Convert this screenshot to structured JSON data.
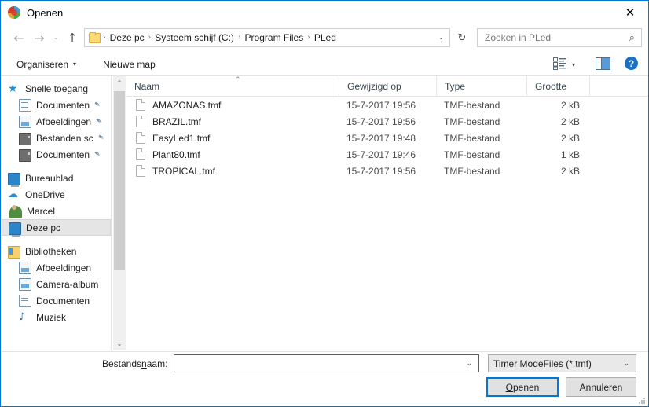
{
  "window": {
    "title": "Openen",
    "app_icon": "pled-logo-icon",
    "close_label": "✕"
  },
  "nav": {
    "back": "←",
    "forward": "→",
    "history": "⌄",
    "up": "↑",
    "refresh": "↻",
    "dropdown_caret": "⌄"
  },
  "address": {
    "folder_icon": "folder-icon",
    "separator": "›",
    "crumbs": [
      {
        "label": "Deze pc"
      },
      {
        "label": "Systeem schijf (C:)"
      },
      {
        "label": "Program Files"
      },
      {
        "label": "PLed"
      }
    ]
  },
  "search": {
    "placeholder": "Zoeken in PLed",
    "value": "",
    "icon": "⌕"
  },
  "commandbar": {
    "organiseren": "Organiseren",
    "nieuwe_map": "Nieuwe map",
    "caret": "▾",
    "help": "?"
  },
  "sidebar": {
    "items": [
      {
        "label": "Snelle toegang",
        "icon": "star-icon",
        "indent": 0,
        "pinned": false,
        "selected": false
      },
      {
        "label": "Documenten",
        "icon": "document-icon",
        "indent": 1,
        "pinned": true,
        "selected": false
      },
      {
        "label": "Afbeeldingen",
        "icon": "picture-icon",
        "indent": 1,
        "pinned": true,
        "selected": false
      },
      {
        "label": "Bestanden sc",
        "icon": "drive-icon",
        "indent": 1,
        "pinned": true,
        "selected": false
      },
      {
        "label": "Documenten",
        "icon": "drive-icon",
        "indent": 1,
        "pinned": true,
        "selected": false
      },
      {
        "label": "Bureaublad",
        "icon": "desktop-icon",
        "indent": 0,
        "pinned": false,
        "selected": false
      },
      {
        "label": "OneDrive",
        "icon": "cloud-icon",
        "indent": 0,
        "pinned": false,
        "selected": false
      },
      {
        "label": "Marcel",
        "icon": "user-icon",
        "indent": 0,
        "pinned": false,
        "selected": false
      },
      {
        "label": "Deze pc",
        "icon": "computer-icon",
        "indent": 0,
        "pinned": false,
        "selected": true
      },
      {
        "label": "Bibliotheken",
        "icon": "library-icon",
        "indent": 0,
        "pinned": false,
        "selected": false
      },
      {
        "label": "Afbeeldingen",
        "icon": "picture-icon",
        "indent": 1,
        "pinned": false,
        "selected": false
      },
      {
        "label": "Camera-album",
        "icon": "picture-icon",
        "indent": 1,
        "pinned": false,
        "selected": false
      },
      {
        "label": "Documenten",
        "icon": "document-icon",
        "indent": 1,
        "pinned": false,
        "selected": false
      },
      {
        "label": "Muziek",
        "icon": "music-icon",
        "indent": 1,
        "pinned": false,
        "selected": false
      }
    ],
    "pin_glyph": "✒",
    "scroll_up": "⌃",
    "scroll_down": "⌄"
  },
  "filelist": {
    "columns": [
      "Naam",
      "Gewijzigd op",
      "Type",
      "Grootte"
    ],
    "sort_caret": "⌃",
    "rows": [
      {
        "name": "AMAZONAS.tmf",
        "modified": "15-7-2017 19:56",
        "type": "TMF-bestand",
        "size": "2 kB"
      },
      {
        "name": "BRAZIL.tmf",
        "modified": "15-7-2017 19:56",
        "type": "TMF-bestand",
        "size": "2 kB"
      },
      {
        "name": "EasyLed1.tmf",
        "modified": "15-7-2017 19:48",
        "type": "TMF-bestand",
        "size": "2 kB"
      },
      {
        "name": "Plant80.tmf",
        "modified": "15-7-2017 19:46",
        "type": "TMF-bestand",
        "size": "1 kB"
      },
      {
        "name": "TROPICAL.tmf",
        "modified": "15-7-2017 19:56",
        "type": "TMF-bestand",
        "size": "2 kB"
      }
    ]
  },
  "bottom": {
    "filename_label_pre": "Bestands",
    "filename_label_accel": "n",
    "filename_label_post": "aam:",
    "filename_value": "",
    "filename_placeholder": "",
    "filter_value": "Timer ModeFiles (*.tmf)",
    "open_label_accel": "O",
    "open_label_post": "penen",
    "cancel_label": "Annuleren",
    "chevron": "⌄"
  },
  "colors": {
    "accent": "#0078d7",
    "help_blue": "#1b72c4",
    "selection": "#e5e5e5"
  }
}
